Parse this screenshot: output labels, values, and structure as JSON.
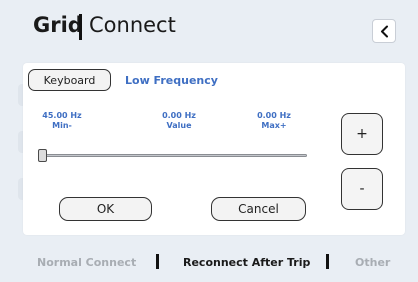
{
  "header": {
    "brand_bold": "Grid",
    "brand_regular": "Connect",
    "back_icon": "chevron-left-icon"
  },
  "panel": {
    "keyboard_label": "Keyboard",
    "title": "Low Frequency",
    "min": {
      "value": "45.00 Hz",
      "label": "Min-"
    },
    "current": {
      "value": "0.00 Hz",
      "label": "Value"
    },
    "max": {
      "value": "0.00 Hz",
      "label": "Max+"
    },
    "slider_fraction": 0,
    "plus_label": "+",
    "minus_label": "-",
    "ok_label": "OK",
    "cancel_label": "Cancel"
  },
  "tabs": [
    {
      "label": "Normal Connect",
      "active": false
    },
    {
      "label": "Reconnect After Trip",
      "active": true
    },
    {
      "label": "Other",
      "active": false
    }
  ],
  "colors": {
    "accent": "#3f6fc3",
    "background": "#e9eef4",
    "inactive_tab": "#a8adb3"
  }
}
